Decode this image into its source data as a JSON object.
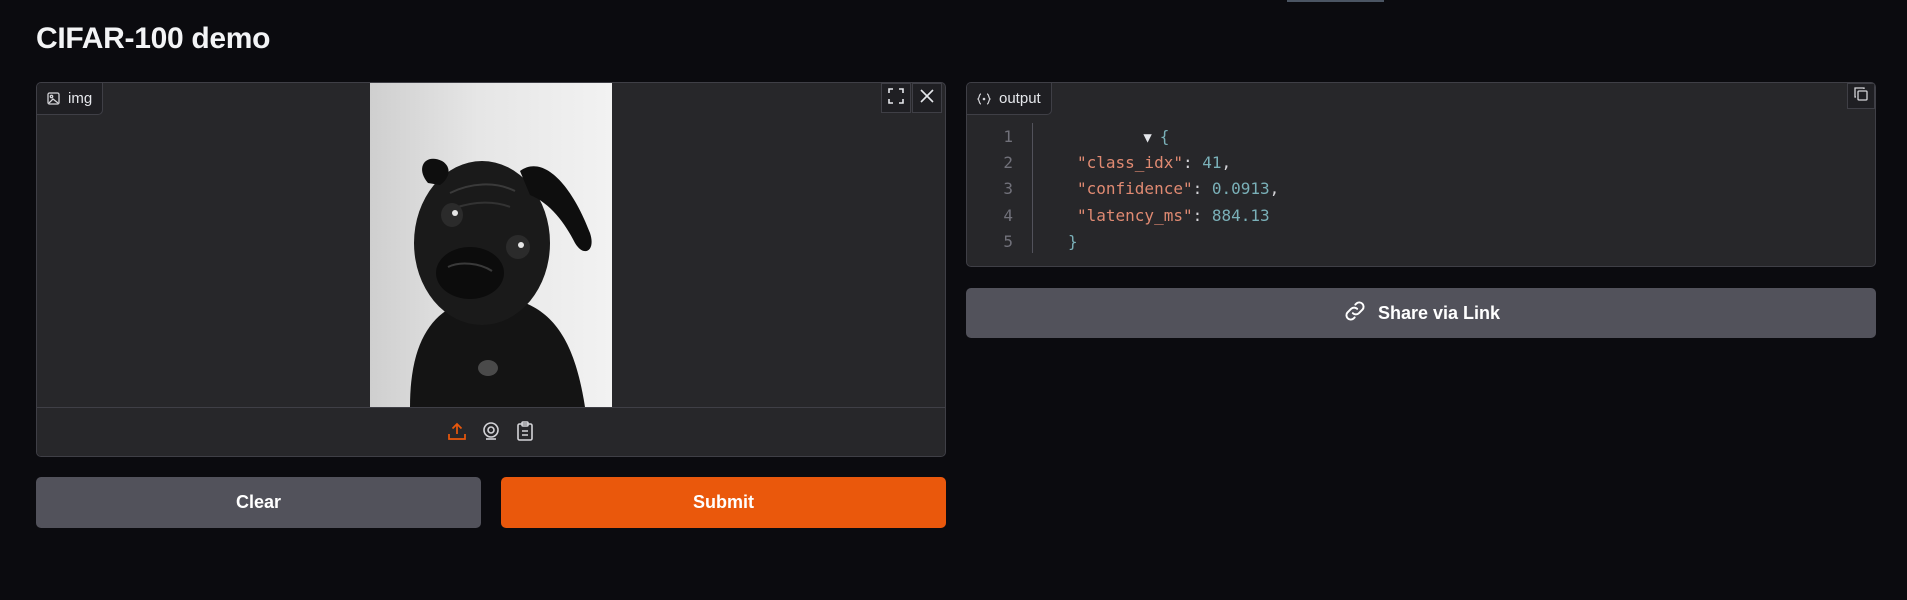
{
  "app": {
    "title": "CIFAR-100 demo"
  },
  "image_input": {
    "label": "img",
    "label_icon": "image-icon",
    "fullscreen_icon": "fullscreen-icon",
    "close_icon": "close-icon",
    "sources": [
      {
        "name": "upload-icon",
        "active": true
      },
      {
        "name": "webcam-icon",
        "active": false
      },
      {
        "name": "clipboard-icon",
        "active": false
      }
    ]
  },
  "buttons": {
    "clear": "Clear",
    "submit": "Submit"
  },
  "output": {
    "label": "output",
    "label_icon": "json-icon",
    "line_numbers": [
      "1",
      "2",
      "3",
      "4",
      "5"
    ],
    "open_brace": "{",
    "close_brace": "}",
    "entries": [
      {
        "key": "\"class_idx\"",
        "value": "41",
        "sep": ","
      },
      {
        "key": "\"confidence\"",
        "value": "0.0913",
        "sep": ","
      },
      {
        "key": "\"latency_ms\"",
        "value": "884.13",
        "sep": ""
      }
    ]
  },
  "share": {
    "label": "Share via Link",
    "icon": "link-icon"
  },
  "colors": {
    "background": "#0b0b0f",
    "panel": "#27272a",
    "primary": "#ea580c",
    "secondary": "#52525b",
    "json_key": "#e08a72",
    "json_number": "#7ab0b8"
  }
}
